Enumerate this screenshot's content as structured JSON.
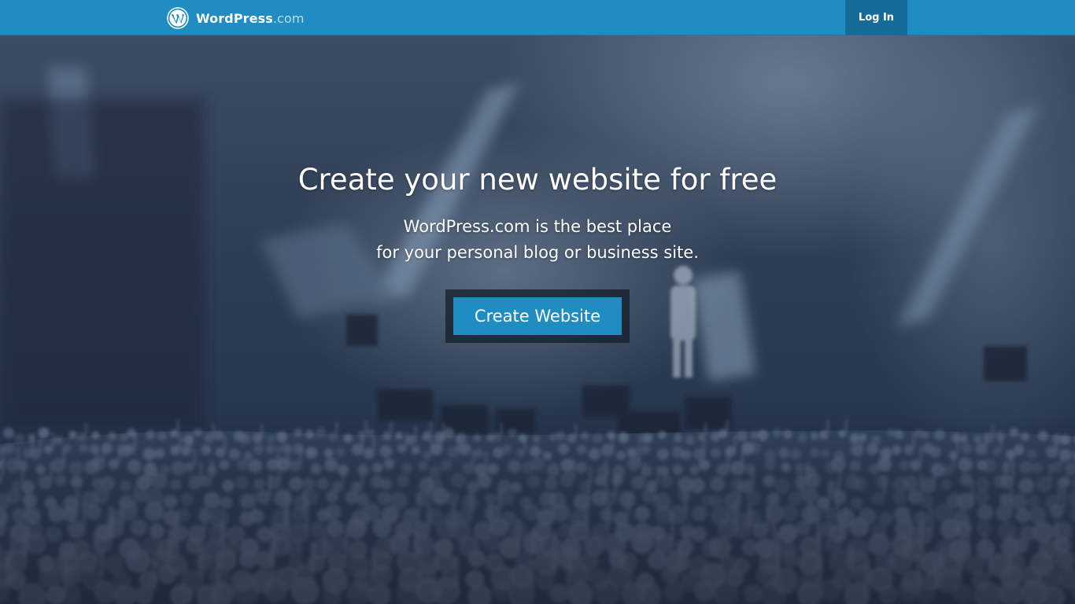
{
  "header": {
    "brand_name": "WordPress",
    "brand_tld": ".com",
    "logo_icon": "wordpress-logo-icon",
    "login_label": "Log In"
  },
  "hero": {
    "headline": "Create your new website for free",
    "subline_1": "WordPress.com is the best place",
    "subline_2": "for your personal blog or business site.",
    "cta_label": "Create Website",
    "background_image": "concert-crowd-photo"
  },
  "colors": {
    "brand_blue": "#1f8dc2",
    "login_bg": "#166c99",
    "hero_tint": "#2b3a4e",
    "text": "#ffffff"
  }
}
